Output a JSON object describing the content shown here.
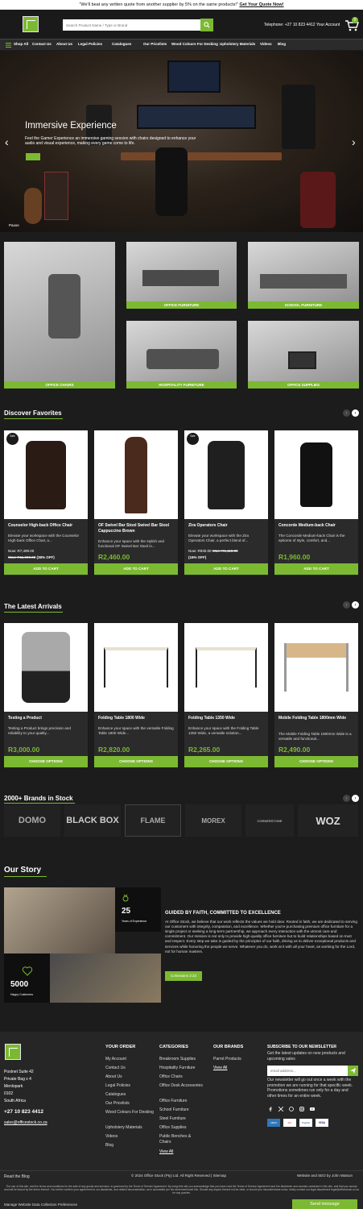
{
  "promo": {
    "text": "\"We'll beat any written quote from another supplier by 5% on the same products!\"",
    "link": "Get Your Quote Now!"
  },
  "header": {
    "search_placeholder": "Search Product Name / Type or Brand",
    "telephone": "Telephone: +27 10 823 4412",
    "account": "Your Account",
    "cart_count": "0"
  },
  "nav": [
    "Shop All",
    "Contact Us",
    "About Us",
    "Legal Policies",
    "Catalogues",
    "Our Pricelists",
    "Wood Colours For Desking",
    "Upholstery Materials",
    "Videos",
    "Blog"
  ],
  "hero": {
    "title": "Immersive Experience",
    "text": "Feel the Gamer Experience an immersive gaming session with chairs designed to enhance your audio and visual experience, making every game come to life.",
    "pause": "Pause"
  },
  "categories": [
    "OFFICE CHAIRS",
    "OFFICE FURNITURE",
    "SCHOOL FURNITURE",
    "HOSPITALITY FURNITURE",
    "OFFICE SUPPLIES"
  ],
  "discover": {
    "title": "Discover Favorites",
    "products": [
      {
        "name": "Counselor High-back Office Chair",
        "desc": "Elevate your workspace with the Counselor High-back Office Chair, a...",
        "now": "Now: R7,499.00",
        "was": "Was: R11,999.00",
        "off": "(38% OFF)",
        "sale": "Sale",
        "button": "ADD TO CART"
      },
      {
        "name": "OF Swivel Bar Stool Swivel Bar Stool Cappuccino Brown",
        "desc": "Enhance your space with the stylish and functional OF Swivel Bar Stool in...",
        "price": "R2,460.00",
        "button": "ADD TO CART"
      },
      {
        "name": "Zira Operators Chair",
        "desc": "Elevate your workspace with the Zira Operators Chair, a perfect blend of...",
        "now": "Now: R930.00",
        "was": "Was: R1,110.00",
        "off": "(16% OFF)",
        "sale": "Sale",
        "button": "ADD TO CART"
      },
      {
        "name": "Concorde Medium-back Chair",
        "desc": "The Concorde Medium-back Chair is the epitome of style, comfort, and...",
        "price": "R1,960.00",
        "button": "ADD TO CART"
      }
    ]
  },
  "arrivals": {
    "title": "The Latest Arrivals",
    "products": [
      {
        "name": "Testing a Product",
        "desc": "Testing a Product brings precision and reliability to your quality...",
        "price": "R3,000.00",
        "button": "CHOOSE OPTIONS"
      },
      {
        "name": "Folding Table 1800 Wide",
        "desc": "Enhance your space with the versatile Folding Table 1800 Wide...",
        "price": "R2,820.00",
        "button": "CHOOSE OPTIONS"
      },
      {
        "name": "Folding Table 1350 Wide",
        "desc": "Enhance your space with the Folding Table 1350 Wide, a versatile solution...",
        "price": "R2,265.00",
        "button": "CHOOSE OPTIONS"
      },
      {
        "name": "Mobile Folding Table 1800mm Wide",
        "desc": "The Mobile Folding Table 1800mm Wide is a versatile and functional...",
        "price": "R2,490.00",
        "button": "CHOOSE OPTIONS"
      }
    ]
  },
  "brands": {
    "title": "2000+ Brands in Stock",
    "logos": [
      "DOMO",
      "BLACK BOX",
      "FLAME",
      "MOREX",
      "CORNERSTONE",
      "WOZ"
    ]
  },
  "story": {
    "title": "Our Story",
    "years": "25",
    "years_label": "Years of Experience",
    "customers": "5000",
    "customers_label": "Happy Customers",
    "heading": "GUIDED BY FAITH, COMMITTED TO EXCELLENCE",
    "body": "At Office Stock, we believe that our work reflects the values we hold dear. Rooted in faith, we are dedicated to serving our customers with integrity, compassion, and excellence. Whether you're purchasing premium office furniture for a single project or seeking a long-term partnership, we approach every interaction with the utmost care and commitment. Our mission is not only to provide high-quality office furniture but to build relationships based on trust and respect. Every step we take is guided by the principles of our faith, driving us to deliver exceptional products and services while honoring the people we serve. Whatever you do, work at it with all your heart, as working for the Lord, not for human masters.",
    "button": "Colossians 3:23"
  },
  "footer": {
    "address": [
      "Postnet Suite 42",
      "Private Bag x 4",
      "Menlopark",
      "0102",
      "South Africa"
    ],
    "phone": "+27 10 823 4412",
    "email": "sales@officestock.co.za",
    "order_title": "YOUR ORDER",
    "order_links": [
      "My Account",
      "Contact Us",
      "About Us",
      "Legal Policies",
      "Catalogues",
      "Our Pricelists",
      "Wood Colours For Desking",
      "Upholstery Materials",
      "Videos",
      "Blog"
    ],
    "cat_title": "CATEGORIES",
    "cat_links": [
      "Breakroom Supplies",
      "Hospitality Furniture",
      "Office Chairs",
      "Office Desk Accessories",
      "Office Furniture",
      "School Furniture",
      "Steel Furniture",
      "Office Supplies",
      "Public Benches & Chairs"
    ],
    "view_all": "View All",
    "brands_title": "OUR BRANDS",
    "brands_links": [
      "Parrot Products"
    ],
    "brands_view_all": "View All",
    "newsletter_title": "SUBSCRIBE TO OUR NEWSLETTER",
    "newsletter_text": "Get the latest updates on new products and upcoming sales",
    "email_placeholder": "email address...",
    "newsletter_note": "Our newsletter will go out once a week with the promotion we are running for that specific week. Promotions sometimes run only for a day and other times for an entire week.",
    "payments": [
      "AMEX",
      "MC",
      "PayPal",
      "VISA"
    ],
    "read_blog": "Read the Blog",
    "copyright": "© 2024 Office Stock (Pty) Ltd. All Right Reserved | Sitemap",
    "credit": "Website and SEO by John Watson",
    "legal": "The use of this site, and the terms and conditions for the sale of any goods and services, is governed by the Terms of Service Agreement. By using this site you acknowledge that you have read the Terms of Service Agreement and the disclaimer and caveats contained in this site, and that you accept and will be bound by the terms thereof. You further confirm your agreement to our disclaimer, and related documentation, as is accessible per the aforementioned link. Should any aspect thereof not be clear, or should you misunderstand some, kindly contact our legal department legal@officestock.co.za for any queries.",
    "data_prefs": "Manage Website Data Collection Preferences",
    "send_message": "Send message"
  },
  "colors": {
    "accent": "#7cb932",
    "bg": "#1c1c1c"
  }
}
